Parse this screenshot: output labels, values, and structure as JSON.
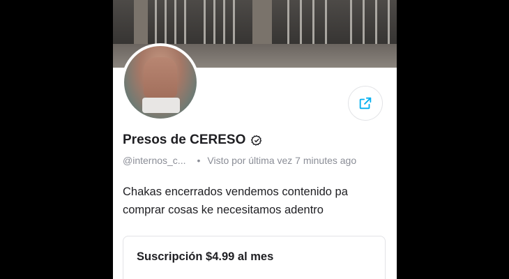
{
  "profile": {
    "name": "Presos de CERESO",
    "handle": "@internos_c...",
    "separator": "•",
    "last_seen": "Visto por última vez 7 minutes ago",
    "bio": "Chakas encerrados vendemos contenido pa comprar cosas ke necesitamos adentro"
  },
  "subscription": {
    "label": "Suscripción $4.99 al mes"
  },
  "icons": {
    "verified": "verified-check-icon",
    "share": "share-icon"
  },
  "colors": {
    "accent": "#00aff0",
    "text": "#1e1e22",
    "muted": "#8a8d96",
    "border": "#e2e3e6"
  }
}
